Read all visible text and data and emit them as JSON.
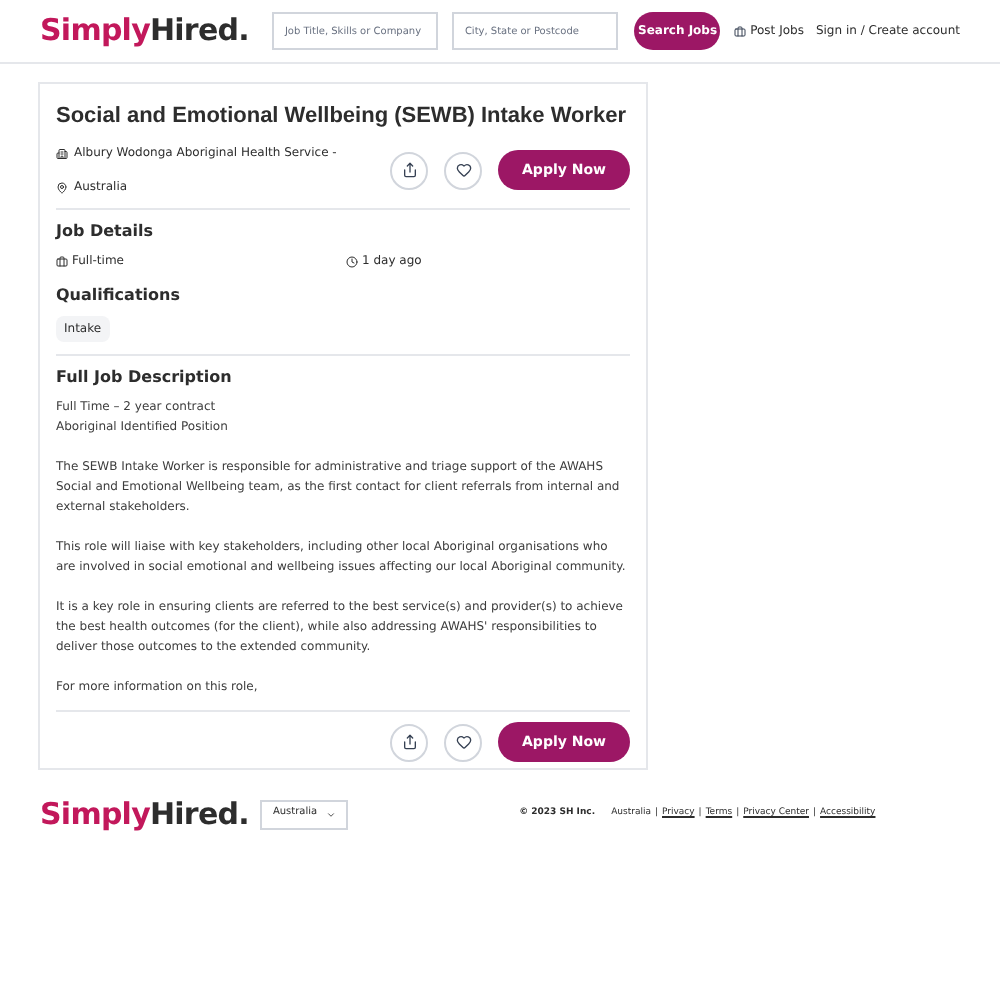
{
  "header": {
    "logo_first": "Simply",
    "logo_second": "Hired.",
    "what_placeholder": "Job Title, Skills or Company",
    "where_placeholder": "City, State or Postcode",
    "search_button": "Search Jobs",
    "post_jobs": "Post Jobs",
    "sign_in": "Sign in / Create account"
  },
  "job": {
    "title": "Social and Emotional Wellbeing (SEWB) Intake Worker",
    "company": "Albury Wodonga Aboriginal Health Service -",
    "location": "Australia",
    "apply": "Apply Now",
    "details_heading": "Job Details",
    "job_type": "Full-time",
    "posted": "1 day ago",
    "qualifications_heading": "Qualifications",
    "qualifications": [
      "Intake"
    ],
    "description_heading": "Full Job Description",
    "description": [
      [
        "Full Time – 2 year contract",
        "Aboriginal Identified Position"
      ],
      [
        "The SEWB Intake Worker is responsible for administrative and triage support of the AWAHS Social and Emotional Wellbeing team, as the first contact for client referrals from internal and external stakeholders."
      ],
      [
        "This role will liaise with key stakeholders, including other local Aboriginal organisations who are involved in social emotional and wellbeing issues affecting our local Aboriginal community."
      ],
      [
        "It is a key role in ensuring clients are referred to the best service(s) and provider(s) to achieve the best health outcomes (for the client), while also addressing AWAHS' responsibilities to deliver those outcomes to the extended community."
      ],
      [
        "For more information on this role,"
      ]
    ],
    "apply_bottom": "Apply Now"
  },
  "footer": {
    "logo_first": "Simply",
    "logo_second": "Hired.",
    "country": "Australia",
    "copyright": "© 2023 SH Inc.",
    "separator": "|",
    "links": [
      {
        "label": "Australia",
        "underlined": false
      },
      {
        "label": "Privacy",
        "underlined": true
      },
      {
        "label": "Terms",
        "underlined": true
      },
      {
        "label": "Privacy Center",
        "underlined": true
      },
      {
        "label": "Accessibility",
        "underlined": true
      }
    ]
  }
}
